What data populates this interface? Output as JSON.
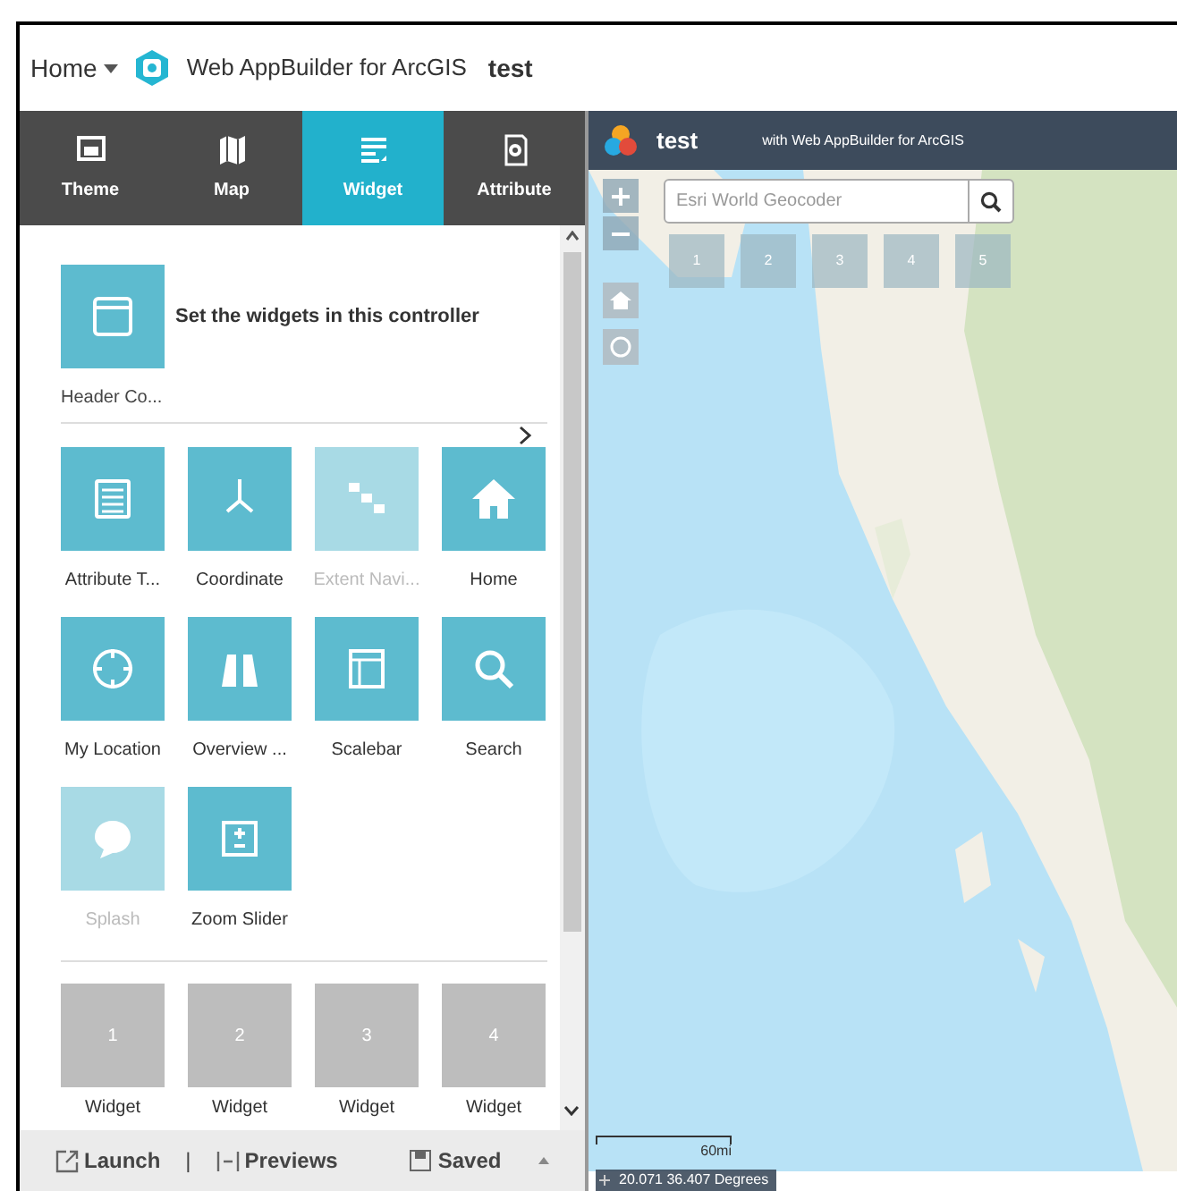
{
  "app_bar": {
    "home": "Home",
    "product": "Web AppBuilder for ArcGIS",
    "app_name": "test"
  },
  "tabs": [
    {
      "label": "Theme",
      "selected": false
    },
    {
      "label": "Map",
      "selected": false
    },
    {
      "label": "Widget",
      "selected": true
    },
    {
      "label": "Attribute",
      "selected": false
    }
  ],
  "panel": {
    "controller": {
      "label": "Header Co...",
      "hint": "Set the widgets in this controller"
    },
    "widgets": [
      {
        "label": "Attribute T...",
        "kind": "table",
        "disabled": false
      },
      {
        "label": "Coordinate",
        "kind": "axes",
        "disabled": false
      },
      {
        "label": "Extent Navi...",
        "kind": "extent",
        "disabled": true
      },
      {
        "label": "Home",
        "kind": "home",
        "disabled": false
      },
      {
        "label": "My Location",
        "kind": "locate",
        "disabled": false
      },
      {
        "label": "Overview ...",
        "kind": "binoculars",
        "disabled": false
      },
      {
        "label": "Scalebar",
        "kind": "scalebar",
        "disabled": false
      },
      {
        "label": "Search",
        "kind": "search",
        "disabled": false
      },
      {
        "label": "Splash",
        "kind": "splash",
        "disabled": true
      },
      {
        "label": "Zoom Slider",
        "kind": "zoom",
        "disabled": false
      }
    ],
    "placeholders": [
      {
        "number": "1",
        "label": "Widget"
      },
      {
        "number": "2",
        "label": "Widget"
      },
      {
        "number": "3",
        "label": "Widget"
      },
      {
        "number": "4",
        "label": "Widget"
      }
    ]
  },
  "footer": {
    "launch": "Launch",
    "separator": "|",
    "previews": "Previews",
    "saved": "Saved"
  },
  "map": {
    "title": "test",
    "subtitle": "with Web AppBuilder for ArcGIS",
    "search": {
      "placeholder": "Esri World Geocoder"
    },
    "slots": [
      "1",
      "2",
      "3",
      "4",
      "5"
    ],
    "scale": "60mi",
    "coordinates": "20.071 36.407 Degrees"
  }
}
